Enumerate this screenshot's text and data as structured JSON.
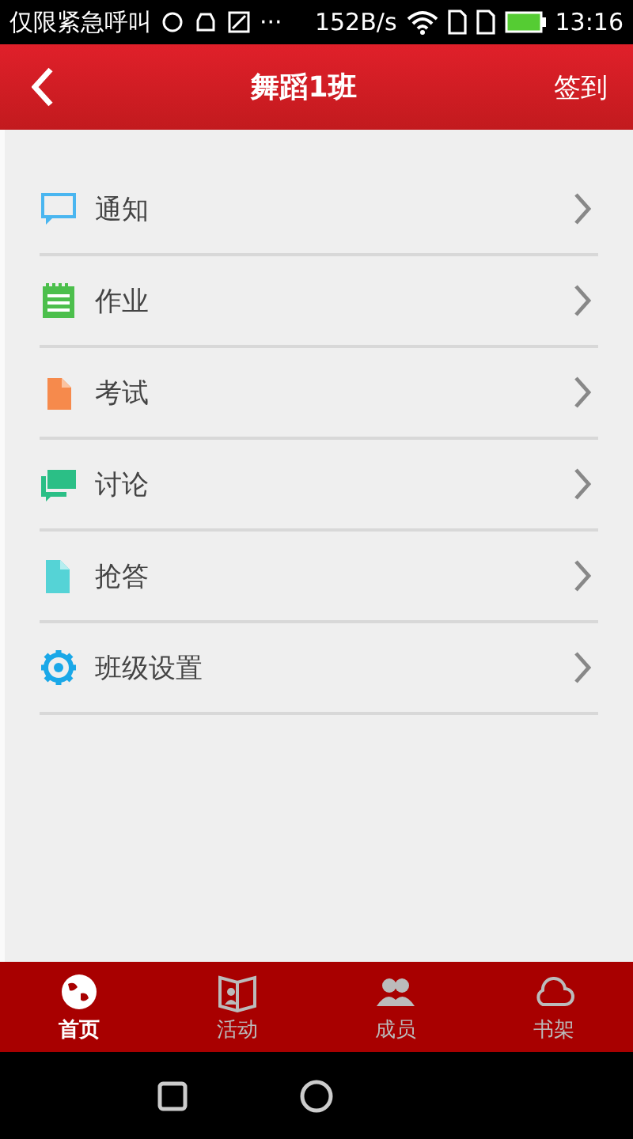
{
  "status_bar": {
    "carrier": "仅限紧急呼叫",
    "ellipsis": "···",
    "speed": "152B/s",
    "time": "13:16"
  },
  "header": {
    "title": "舞蹈1班",
    "action": "签到"
  },
  "menu": [
    {
      "kind": "notice",
      "label": "通知"
    },
    {
      "kind": "homework",
      "label": "作业"
    },
    {
      "kind": "exam",
      "label": "考试"
    },
    {
      "kind": "discussion",
      "label": "讨论"
    },
    {
      "kind": "quiz",
      "label": "抢答"
    },
    {
      "kind": "settings",
      "label": "班级设置"
    }
  ],
  "tabs": [
    {
      "kind": "home",
      "label": "首页",
      "selected": true
    },
    {
      "kind": "activity",
      "label": "活动",
      "selected": false
    },
    {
      "kind": "members",
      "label": "成员",
      "selected": false
    },
    {
      "kind": "bookshelf",
      "label": "书架",
      "selected": false
    }
  ]
}
